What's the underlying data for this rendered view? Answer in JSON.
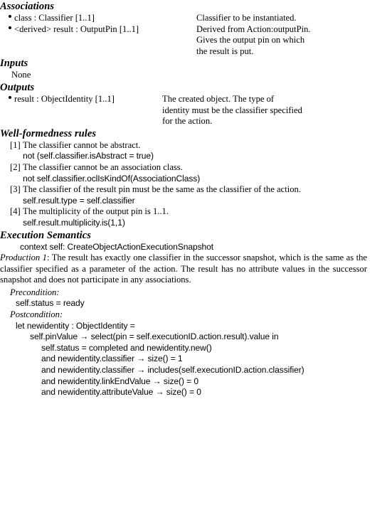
{
  "document": {
    "sections": {
      "associations": {
        "heading": "Associations",
        "items": [
          {
            "bullet": "•",
            "name": "class : Classifier [1..1]",
            "description": [
              "Classifier to be instantiated."
            ]
          },
          {
            "bullet": "•",
            "name": "<derived> result : OutputPin [1..1]",
            "description": [
              "Derived from Action:outputPin.",
              "Gives the output pin on which",
              "the result is put."
            ]
          }
        ]
      },
      "inputs": {
        "heading": "Inputs",
        "value": "None"
      },
      "outputs": {
        "heading": "Outputs",
        "items": [
          {
            "bullet": "•",
            "name": "result : ObjectIdentity [1..1]",
            "description": [
              "The created object. The type of",
              "identity must be the classifier specified",
              "for the action."
            ]
          }
        ]
      },
      "well_formedness": {
        "heading": "Well-formedness rules",
        "rules": [
          {
            "number": "[1]",
            "text": "The classifier cannot be abstract.",
            "ocl": "not (self.classifier.isAbstract = true)"
          },
          {
            "number": "[2]",
            "text": "The classifier cannot be an association class.",
            "ocl": "not self.classifier.oclIsKindOf(AssociationClass)"
          },
          {
            "number": "[3]",
            "text": "The classifier of the result pin must be the same as the classifier of the action.",
            "ocl": "self.result.type = self.classifier"
          },
          {
            "number": "[4]",
            "text": "The multiplicity of the output pin is 1..1.",
            "ocl": "self.result.multiplicity.is(1,1)"
          }
        ]
      },
      "execution_semantics": {
        "heading": "Execution Semantics",
        "context": "context self: CreateObjectActionExecutionSnapshot",
        "production_label": "Production 1",
        "production_separator": ": ",
        "production_text": "The result has exactly one classifier in the successor snapshot, which is the same as the classifier specified as a parameter of the action. The result has no attribute values in the successor snapshot and does not participate in any associations.",
        "precondition_label": "Precondition:",
        "precondition_ocl": "self.status = ready",
        "postcondition_label": "Postcondition:",
        "postcondition_ocl_lines": [
          {
            "indent": 1,
            "text": "let newidentity : ObjectIdentity ="
          },
          {
            "indent": 2,
            "text": "self.pinValue → select(pin = self.executionID.action.result).value in"
          },
          {
            "indent": 3,
            "text": "self.status = completed and newidentity.new()"
          },
          {
            "indent": 3,
            "text": "and newidentity.classifier → size() = 1"
          },
          {
            "indent": 3,
            "text": "and newidentity.classifier → includes(self.executionID.action.classifier)"
          },
          {
            "indent": 3,
            "text": "and newidentity.linkEndValue → size() = 0"
          },
          {
            "indent": 3,
            "text": "and newidentity.attributeValue → size() = 0"
          }
        ]
      }
    }
  }
}
